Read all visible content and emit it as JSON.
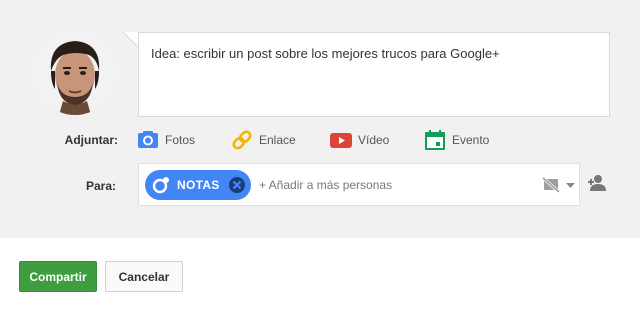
{
  "composer": {
    "post_text": "Idea: escribir un post sobre los mejores trucos para Google+"
  },
  "attach": {
    "label": "Adjuntar:",
    "items": [
      {
        "label": "Fotos",
        "icon": "camera-icon",
        "color": "#4285f4"
      },
      {
        "label": "Enlace",
        "icon": "link-icon",
        "color": "#f4b400"
      },
      {
        "label": "Vídeo",
        "icon": "video-icon",
        "color": "#db4437"
      },
      {
        "label": "Evento",
        "icon": "calendar-icon",
        "color": "#0f9d58"
      }
    ]
  },
  "to": {
    "label": "Para:",
    "chip_label": "NOTAS",
    "add_placeholder": "+ Añadir a más personas"
  },
  "actions": {
    "share_label": "Compartir",
    "cancel_label": "Cancelar"
  },
  "colors": {
    "chip": "#4285f4",
    "share": "#3e9e3f",
    "panel": "#f1f1f1"
  }
}
